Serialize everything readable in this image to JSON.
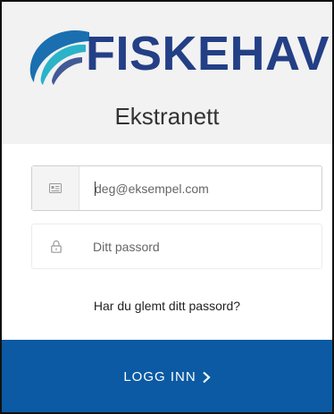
{
  "brand": {
    "name": "FISKEHAV",
    "subtitle": "Ekstranett",
    "text_color": "#233f86",
    "wave_colors": [
      "#2bb3c9",
      "#1a6fb0",
      "#233f86"
    ]
  },
  "login_form": {
    "email": {
      "icon": "id-card-icon",
      "value": "",
      "placeholder": "deg@eksempel.com"
    },
    "password": {
      "icon": "lock-icon",
      "value": "",
      "placeholder": "Ditt passord"
    },
    "forgot_link": "Har du glemt ditt passord?",
    "submit": {
      "label": "LOGG INN",
      "icon": "chevron-right-icon",
      "color": "#0b5aa3"
    }
  },
  "colors": {
    "header_background": "#f2f2f2",
    "frame_border": "#111111"
  }
}
